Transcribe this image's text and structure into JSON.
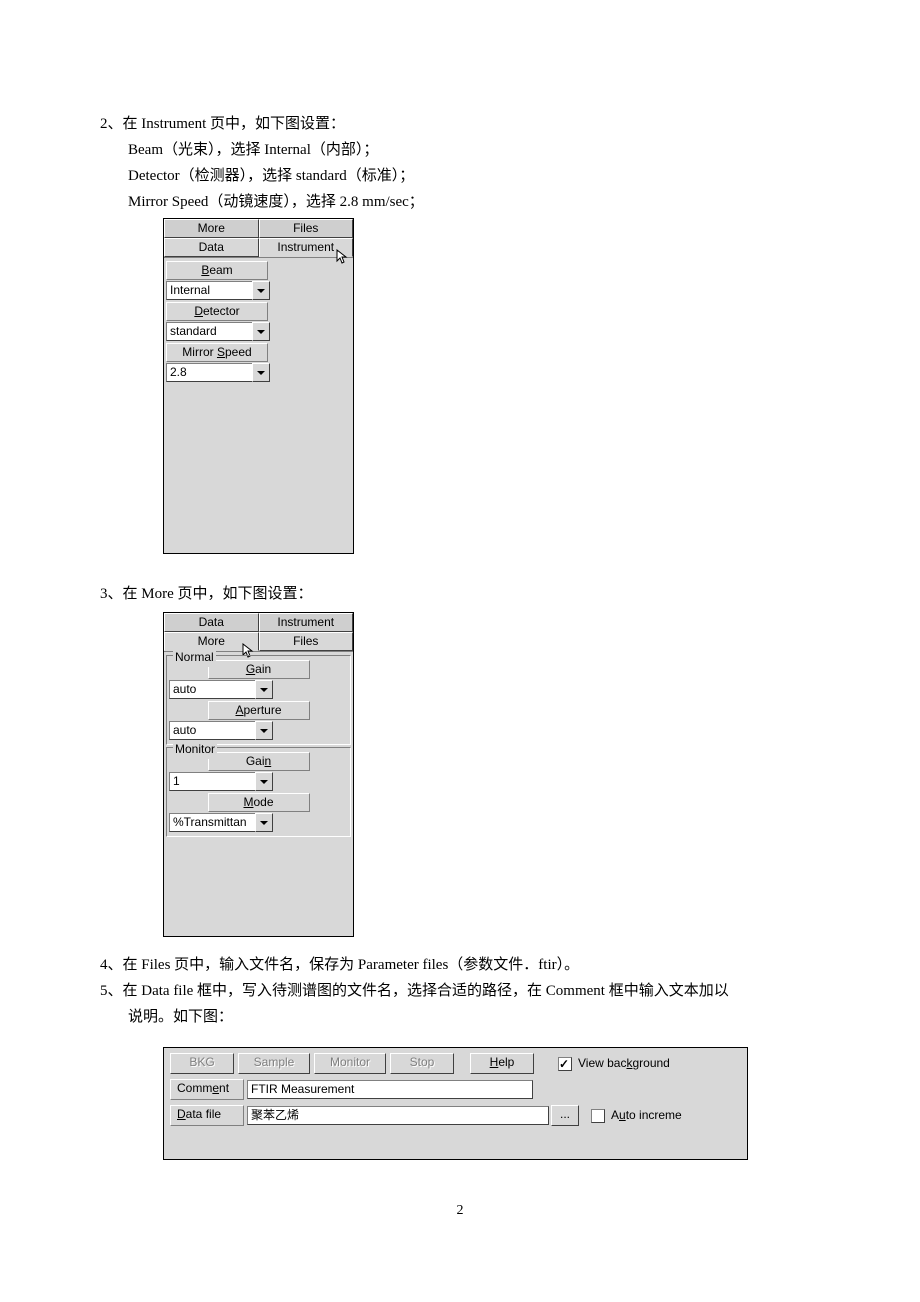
{
  "text": {
    "s2_line1": "2、在 Instrument 页中，如下图设置：",
    "s2_line2": "Beam（光束），选择 Internal（内部）；",
    "s2_line3": "Detector（检测器），选择 standard（标准）；",
    "s2_line4": "Mirror Speed（动镜速度），选择 2.8 mm/sec；",
    "s3_line1": "3、在 More 页中，如下图设置：",
    "s4_line1": "4、在 Files 页中，输入文件名，保存为 Parameter files（参数文件．ftir）。",
    "s5_line1": "5、在 Data file 框中，写入待测谱图的文件名，选择合适的路径，在 Comment 框中输入文本加以",
    "s5_line2": "说明。如下图：",
    "page_num": "2"
  },
  "panel1": {
    "tabs_back": [
      "More",
      "Files"
    ],
    "tabs_front": [
      "Data",
      "Instrument"
    ],
    "fields": {
      "beam_label": "Beam",
      "beam_value": "Internal",
      "detector_label": "Detector",
      "detector_value": "standard",
      "mirror_label": "Mirror Speed",
      "mirror_value": "2.8"
    }
  },
  "panel2": {
    "tabs_back": [
      "Data",
      "Instrument"
    ],
    "tabs_front": [
      "More",
      "Files"
    ],
    "group1": {
      "title": "Normal",
      "gain_label": "Gain",
      "gain_value": "auto",
      "aperture_label": "Aperture",
      "aperture_value": "auto"
    },
    "group2": {
      "title": "Monitor",
      "gain_label": "Gain",
      "gain_value": "1",
      "mode_label": "Mode",
      "mode_value": "%Transmittan"
    }
  },
  "panel3": {
    "buttons": {
      "bkg": "BKG",
      "sample": "Sample",
      "monitor": "Monitor",
      "stop": "Stop",
      "help": "Help",
      "browse": "..."
    },
    "view_bg": "View background",
    "comment_label": "Comment",
    "comment_value": "FTIR Measurement",
    "datafile_label": "Data file",
    "datafile_value": "聚苯乙烯",
    "auto_incr": "Auto increme"
  }
}
